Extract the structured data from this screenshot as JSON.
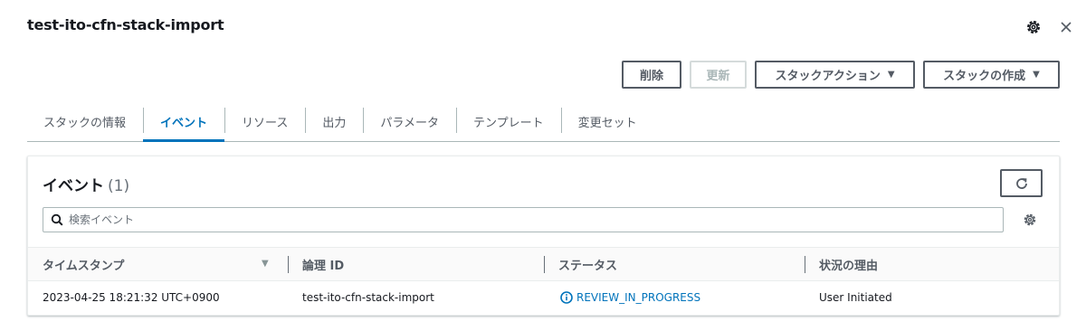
{
  "stack": {
    "title": "test-ito-cfn-stack-import"
  },
  "header_icons": {
    "settings": "gear-icon",
    "close": "close-icon"
  },
  "actions": {
    "delete_label": "削除",
    "update_label": "更新",
    "stack_actions_label": "スタックアクション",
    "create_stack_label": "スタックの作成",
    "caret": "▼"
  },
  "tabs": [
    {
      "label": "スタックの情報",
      "active": false
    },
    {
      "label": "イベント",
      "active": true
    },
    {
      "label": "リソース",
      "active": false
    },
    {
      "label": "出力",
      "active": false
    },
    {
      "label": "パラメータ",
      "active": false
    },
    {
      "label": "テンプレート",
      "active": false
    },
    {
      "label": "変更セット",
      "active": false
    }
  ],
  "events": {
    "title": "イベント",
    "count": "(1)",
    "search_placeholder": "検索イベント",
    "columns": [
      "タイムスタンプ",
      "論理 ID",
      "ステータス",
      "状況の理由"
    ],
    "sort_caret": "▼",
    "rows": [
      {
        "timestamp": "2023-04-25 18:21:32 UTC+0900",
        "logical_id": "test-ito-cfn-stack-import",
        "status": "REVIEW_IN_PROGRESS",
        "reason": "User Initiated"
      }
    ]
  },
  "colors": {
    "accent": "#0073bb",
    "text": "#16191f",
    "muted": "#545b64",
    "border": "#aab7b8"
  }
}
